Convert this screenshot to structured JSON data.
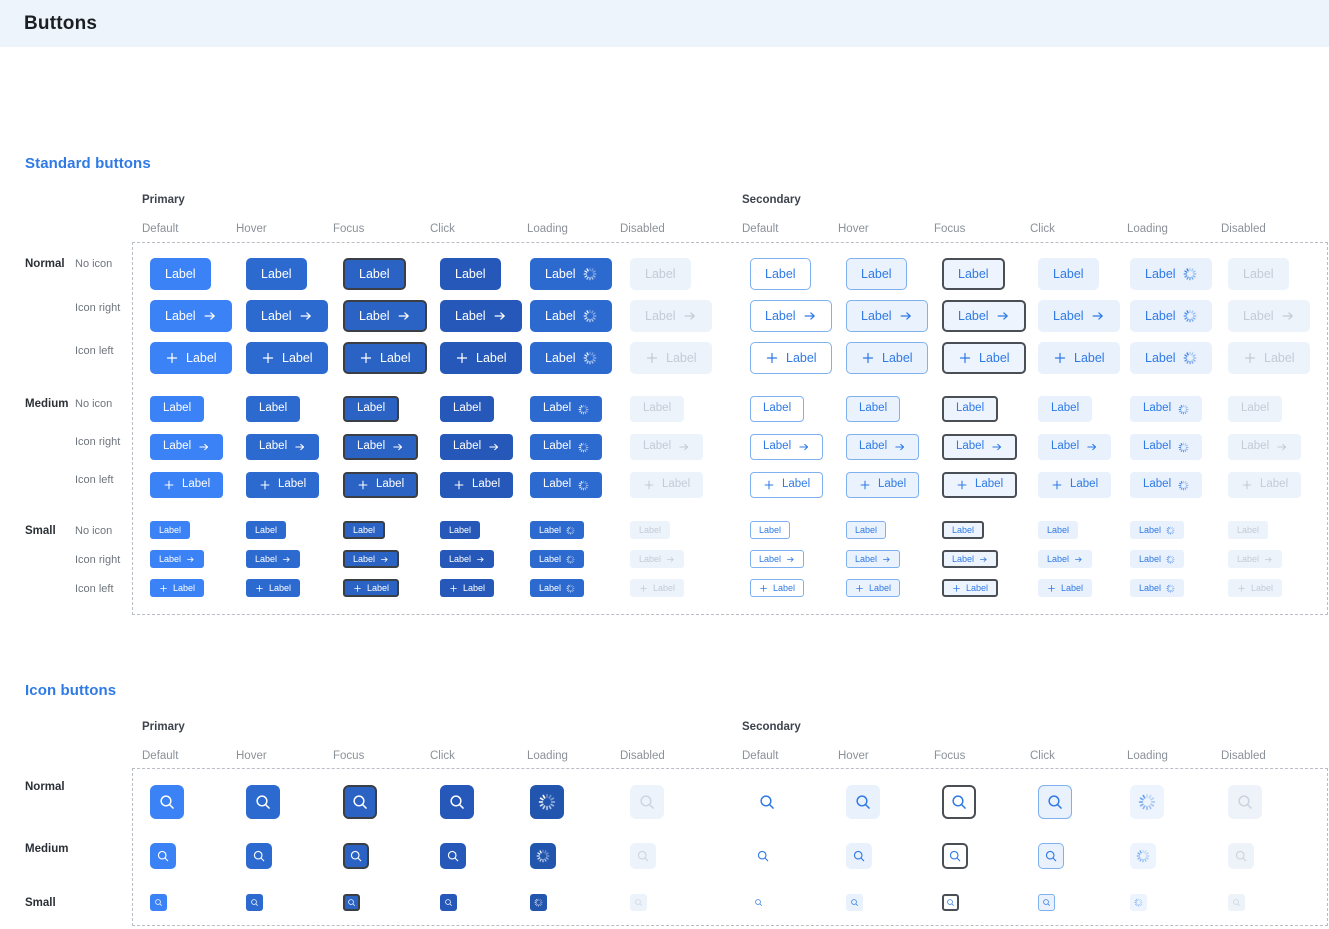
{
  "header": {
    "title": "Buttons"
  },
  "colors": {
    "accent": "#2f7ae5",
    "primary_default": "#3b82f6",
    "primary_hover": "#2d6ad0",
    "primary_focus_outline": "#3a3f45",
    "primary_click": "#2558b8",
    "disabled_bg": "#edf3fb",
    "disabled_text": "#c3cbd6",
    "secondary_border": "#7fb0f0",
    "secondary_tint": "#e9f1fd",
    "header_bg": "#eef4fc",
    "dashed_border": "#b9bec5"
  },
  "sections": [
    {
      "id": "standard",
      "title": "Standard buttons",
      "groups": [
        "Primary",
        "Secondary"
      ],
      "states": [
        "Default",
        "Hover",
        "Focus",
        "Click",
        "Loading",
        "Disabled"
      ],
      "sizes": [
        "Normal",
        "Medium",
        "Small"
      ],
      "variants": [
        "No icon",
        "Icon right",
        "Icon left"
      ],
      "button_label": "Label",
      "icons": {
        "right": "arrow-right-icon",
        "left": "plus-icon",
        "loading": "spinner-icon"
      }
    },
    {
      "id": "icon",
      "title": "Icon buttons",
      "groups": [
        "Primary",
        "Secondary"
      ],
      "states": [
        "Default",
        "Hover",
        "Focus",
        "Click",
        "Loading",
        "Disabled"
      ],
      "sizes": [
        "Normal",
        "Medium",
        "Small"
      ],
      "icons": {
        "glyph": "search-icon",
        "loading": "spinner-icon"
      }
    }
  ]
}
